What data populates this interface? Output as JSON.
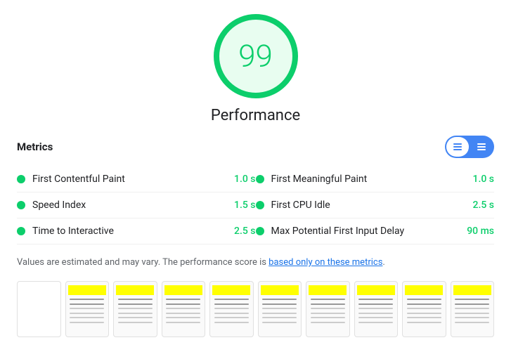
{
  "score": {
    "value": "99",
    "label": "Performance",
    "color": "#0cce6b"
  },
  "metrics": {
    "title": "Metrics",
    "toggle": {
      "list_icon": "≡",
      "grid_icon": "⊟"
    },
    "left": [
      {
        "name": "First Contentful Paint",
        "value": "1.0 s",
        "dot_color": "#0cce6b"
      },
      {
        "name": "Speed Index",
        "value": "1.5 s",
        "dot_color": "#0cce6b"
      },
      {
        "name": "Time to Interactive",
        "value": "2.5 s",
        "dot_color": "#0cce6b"
      }
    ],
    "right": [
      {
        "name": "First Meaningful Paint",
        "value": "1.0 s",
        "dot_color": "#0cce6b"
      },
      {
        "name": "First CPU Idle",
        "value": "2.5 s",
        "dot_color": "#0cce6b"
      },
      {
        "name": "Max Potential First Input Delay",
        "value": "90 ms",
        "dot_color": "#0cce6b"
      }
    ]
  },
  "note": {
    "text_before": "Values are estimated and may vary. The performance score is ",
    "link_text": "based only on these metrics",
    "text_after": "."
  },
  "filmstrip": {
    "frame_count": 10
  }
}
